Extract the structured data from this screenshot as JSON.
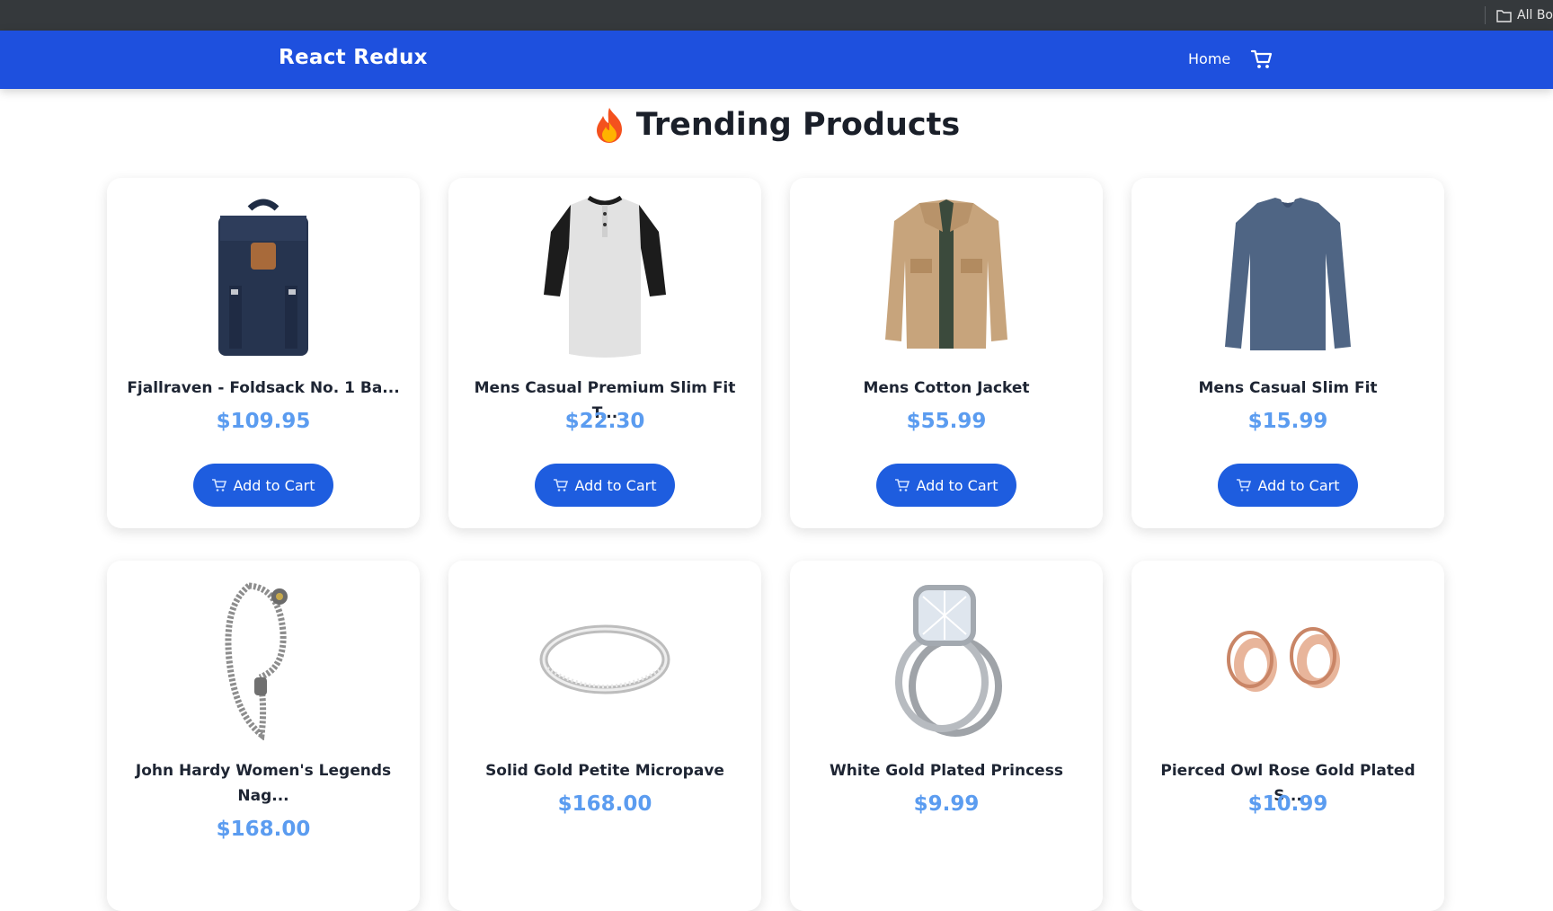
{
  "browser": {
    "bookmarks_label": "All Bo"
  },
  "navbar": {
    "brand": "React Redux",
    "home_label": "Home"
  },
  "heading": {
    "title": "Trending Products"
  },
  "colors": {
    "nav": "#1e50de",
    "price": "#5b9cf0",
    "button": "#1e5ddf"
  },
  "products": [
    {
      "title": "Fjallraven - Foldsack No. 1 Ba...",
      "price": "$109.95",
      "button": "Add to Cart",
      "image": "backpack"
    },
    {
      "title": "Mens Casual Premium Slim Fit T...",
      "price": "$22.30",
      "button": "Add to Cart",
      "image": "henley-shirt"
    },
    {
      "title": "Mens Cotton Jacket",
      "price": "$55.99",
      "button": "Add to Cart",
      "image": "jacket"
    },
    {
      "title": "Mens Casual Slim Fit",
      "price": "$15.99",
      "button": "Add to Cart",
      "image": "long-sleeve-shirt"
    },
    {
      "title": "John Hardy Women's Legends Nag...",
      "price": "$168.00",
      "image": "bracelet"
    },
    {
      "title": "Solid Gold Petite Micropave",
      "price": "$168.00",
      "image": "ring"
    },
    {
      "title": "White Gold Plated Princess",
      "price": "$9.99",
      "image": "diamond-ring"
    },
    {
      "title": "Pierced Owl Rose Gold Plated S...",
      "price": "$10.99",
      "image": "ear-plugs"
    }
  ]
}
